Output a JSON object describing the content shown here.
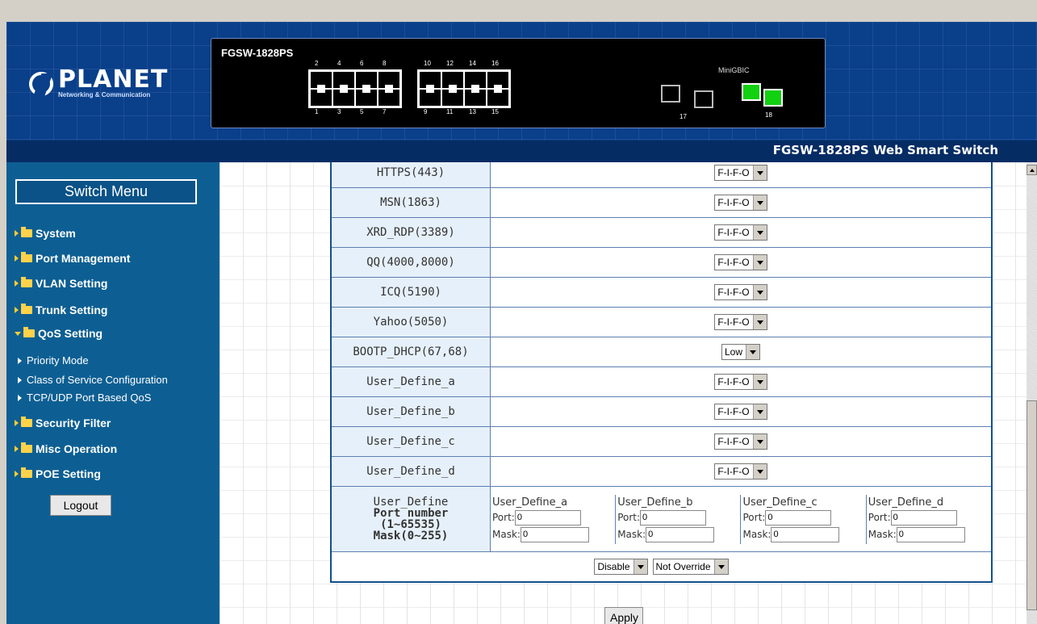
{
  "header": {
    "logo_name": "PLANET",
    "logo_sub": "Networking & Communication",
    "model": "FGSW-1828PS",
    "brand_title": "FGSW-1828PS Web Smart Switch",
    "minigbic_label": "MiniGBIC",
    "ports_top": [
      "2",
      "4",
      "6",
      "8",
      "10",
      "12",
      "14",
      "16"
    ],
    "ports_bottom": [
      "1",
      "3",
      "5",
      "7",
      "9",
      "11",
      "13",
      "15"
    ],
    "gbic_labels": [
      "17",
      "18"
    ]
  },
  "sidebar": {
    "title": "Switch Menu",
    "items": [
      {
        "label": "System"
      },
      {
        "label": "Port Management"
      },
      {
        "label": "VLAN Setting"
      },
      {
        "label": "Trunk Setting"
      },
      {
        "label": "QoS Setting"
      },
      {
        "label": "Security Filter"
      },
      {
        "label": "Misc Operation"
      },
      {
        "label": "POE Setting"
      }
    ],
    "sub_items": [
      {
        "label": "Priority Mode"
      },
      {
        "label": "Class of Service Configuration"
      },
      {
        "label": "TCP/UDP Port Based QoS"
      }
    ],
    "logout": "Logout"
  },
  "table": {
    "rows": [
      {
        "label": "HTTPS(443)",
        "value": "F-I-F-O"
      },
      {
        "label": "MSN(1863)",
        "value": "F-I-F-O"
      },
      {
        "label": "XRD_RDP(3389)",
        "value": "F-I-F-O"
      },
      {
        "label": "QQ(4000,8000)",
        "value": "F-I-F-O"
      },
      {
        "label": "ICQ(5190)",
        "value": "F-I-F-O"
      },
      {
        "label": "Yahoo(5050)",
        "value": "F-I-F-O"
      },
      {
        "label": "BOOTP_DHCP(67,68)",
        "value": "Low"
      },
      {
        "label": "User_Define_a",
        "value": "F-I-F-O"
      },
      {
        "label": "User_Define_b",
        "value": "F-I-F-O"
      },
      {
        "label": "User_Define_c",
        "value": "F-I-F-O"
      },
      {
        "label": "User_Define_d",
        "value": "F-I-F-O"
      }
    ],
    "user_define": {
      "label_lines": [
        "User_Define",
        "Port number",
        "(1~65535)",
        "Mask(0~255)"
      ],
      "port_label": "Port:",
      "mask_label": "Mask:",
      "columns": [
        {
          "name": "User_Define_a",
          "port": "0",
          "mask": "0"
        },
        {
          "name": "User_Define_b",
          "port": "0",
          "mask": "0"
        },
        {
          "name": "User_Define_c",
          "port": "0",
          "mask": "0"
        },
        {
          "name": "User_Define_d",
          "port": "0",
          "mask": "0"
        }
      ]
    },
    "footer_selects": [
      "Disable",
      "Not Override"
    ]
  },
  "apply": "Apply"
}
